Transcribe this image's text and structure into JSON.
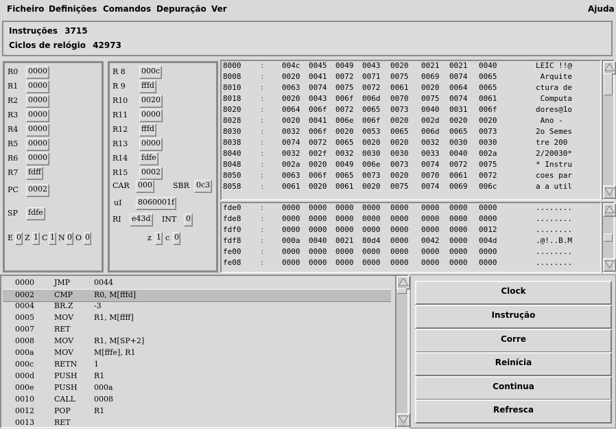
{
  "menu": {
    "items": [
      "Ficheiro",
      "Definições",
      "Comandos",
      "Depuração",
      "Ver"
    ],
    "help": "Ajuda"
  },
  "info": {
    "instructions_label": "Instruções",
    "instructions_value": "3715",
    "cycles_label": "Ciclos de relógio",
    "cycles_value": "42973"
  },
  "registers": {
    "r0": {
      "label": "R0",
      "value": "0000"
    },
    "r1": {
      "label": "R1",
      "value": "0000"
    },
    "r2": {
      "label": "R2",
      "value": "0000"
    },
    "r3": {
      "label": "R3",
      "value": "0000"
    },
    "r4": {
      "label": "R4",
      "value": "0000"
    },
    "r5": {
      "label": "R5",
      "value": "0000"
    },
    "r6": {
      "label": "R6",
      "value": "0000"
    },
    "r7": {
      "label": "R7",
      "value": "fdff"
    },
    "pc": {
      "label": "PC",
      "value": "0002"
    },
    "sp": {
      "label": "SP",
      "value": "fdfe"
    },
    "r8": {
      "label": "R 8",
      "value": "000c"
    },
    "r9": {
      "label": "R 9",
      "value": "fffd"
    },
    "r10": {
      "label": "R10",
      "value": "0020"
    },
    "r11": {
      "label": "R11",
      "value": "0000"
    },
    "r12": {
      "label": "R12",
      "value": "fffd"
    },
    "r13": {
      "label": "R13",
      "value": "0000"
    },
    "r14": {
      "label": "R14",
      "value": "fdfe"
    },
    "r15": {
      "label": "R15",
      "value": "0002"
    },
    "car": {
      "label": "CAR",
      "value": "000"
    },
    "sbr": {
      "label": "SBR",
      "value": "0c3"
    },
    "ui": {
      "label": "uI",
      "value": "8060001f"
    },
    "ri": {
      "label": "RI",
      "value": "e43d"
    },
    "int": {
      "label": "INT",
      "value": "0"
    }
  },
  "flags": {
    "e": {
      "label": "E",
      "value": "0"
    },
    "z": {
      "label": "Z",
      "value": "1"
    },
    "c": {
      "label": "C",
      "value": "1"
    },
    "n": {
      "label": "N",
      "value": "0"
    },
    "o": {
      "label": "O",
      "value": "0"
    },
    "z2": {
      "label": "z",
      "value": "1"
    },
    "c2": {
      "label": "c",
      "value": "0"
    }
  },
  "memory_top": [
    {
      "addr": "8000",
      "words": [
        "004c",
        "0045",
        "0049",
        "0043",
        "0020",
        "0021",
        "0021",
        "0040"
      ],
      "ascii": "LEIC !!@"
    },
    {
      "addr": "8008",
      "words": [
        "0020",
        "0041",
        "0072",
        "0071",
        "0075",
        "0069",
        "0074",
        "0065"
      ],
      "ascii": " Arquite"
    },
    {
      "addr": "8010",
      "words": [
        "0063",
        "0074",
        "0075",
        "0072",
        "0061",
        "0020",
        "0064",
        "0065"
      ],
      "ascii": "ctura de"
    },
    {
      "addr": "8018",
      "words": [
        "0020",
        "0043",
        "006f",
        "006d",
        "0070",
        "0075",
        "0074",
        "0061"
      ],
      "ascii": " Computa"
    },
    {
      "addr": "8020",
      "words": [
        "0064",
        "006f",
        "0072",
        "0065",
        "0073",
        "0040",
        "0031",
        "006f"
      ],
      "ascii": "dores@1o"
    },
    {
      "addr": "8028",
      "words": [
        "0020",
        "0041",
        "006e",
        "006f",
        "0020",
        "002d",
        "0020",
        "0020"
      ],
      "ascii": " Ano - "
    },
    {
      "addr": "8030",
      "words": [
        "0032",
        "006f",
        "0020",
        "0053",
        "0065",
        "006d",
        "0065",
        "0073"
      ],
      "ascii": "2o Semes"
    },
    {
      "addr": "8038",
      "words": [
        "0074",
        "0072",
        "0065",
        "0020",
        "0020",
        "0032",
        "0030",
        "0030"
      ],
      "ascii": "tre 200"
    },
    {
      "addr": "8040",
      "words": [
        "0032",
        "002f",
        "0032",
        "0030",
        "0030",
        "0033",
        "0040",
        "002a"
      ],
      "ascii": "2/20030*"
    },
    {
      "addr": "8048",
      "words": [
        "002a",
        "0020",
        "0049",
        "006e",
        "0073",
        "0074",
        "0072",
        "0075"
      ],
      "ascii": "* Instru"
    },
    {
      "addr": "8050",
      "words": [
        "0063",
        "006f",
        "0065",
        "0073",
        "0020",
        "0070",
        "0061",
        "0072"
      ],
      "ascii": "coes par"
    },
    {
      "addr": "8058",
      "words": [
        "0061",
        "0020",
        "0061",
        "0020",
        "0075",
        "0074",
        "0069",
        "006c"
      ],
      "ascii": "a a util"
    }
  ],
  "memory_bottom": [
    {
      "addr": "fde0",
      "words": [
        "0000",
        "0000",
        "0000",
        "0000",
        "0000",
        "0000",
        "0000",
        "0000"
      ],
      "ascii": "........"
    },
    {
      "addr": "fde8",
      "words": [
        "0000",
        "0000",
        "0000",
        "0000",
        "0000",
        "0000",
        "0000",
        "0000"
      ],
      "ascii": "........"
    },
    {
      "addr": "fdf0",
      "words": [
        "0000",
        "0000",
        "0000",
        "0000",
        "0000",
        "0000",
        "0000",
        "0012"
      ],
      "ascii": "........"
    },
    {
      "addr": "fdf8",
      "words": [
        "000a",
        "0040",
        "0021",
        "80d4",
        "0000",
        "0042",
        "0000",
        "004d"
      ],
      "ascii": ".@!..B.M"
    },
    {
      "addr": "fe00",
      "words": [
        "0000",
        "0000",
        "0000",
        "0000",
        "0000",
        "0000",
        "0000",
        "0000"
      ],
      "ascii": "........"
    },
    {
      "addr": "fe08",
      "words": [
        "0000",
        "0000",
        "0000",
        "0000",
        "0000",
        "0000",
        "0000",
        "0000"
      ],
      "ascii": "........"
    }
  ],
  "code": [
    {
      "addr": "0000",
      "op": "JMP",
      "args": "0044"
    },
    {
      "addr": "0002",
      "op": "CMP",
      "args": "R0, M[fffd]"
    },
    {
      "addr": "0004",
      "op": "BR.Z",
      "args": "-3"
    },
    {
      "addr": "0005",
      "op": "MOV",
      "args": "R1, M[ffff]"
    },
    {
      "addr": "0007",
      "op": "RET",
      "args": ""
    },
    {
      "addr": "0008",
      "op": "MOV",
      "args": "R1, M[SP+2]"
    },
    {
      "addr": "000a",
      "op": "MOV",
      "args": "M[fffe], R1"
    },
    {
      "addr": "000c",
      "op": "RETN",
      "args": "1"
    },
    {
      "addr": "000d",
      "op": "PUSH",
      "args": "R1"
    },
    {
      "addr": "000e",
      "op": "PUSH",
      "args": "000a"
    },
    {
      "addr": "0010",
      "op": "CALL",
      "args": "0008"
    },
    {
      "addr": "0012",
      "op": "POP",
      "args": "R1"
    },
    {
      "addr": "0013",
      "op": "RET",
      "args": ""
    }
  ],
  "code_selected_index": 1,
  "buttons": {
    "clock": "Clock",
    "instrucao": "Instrução",
    "corre": "Corre",
    "reinicia": "Reinícia",
    "continua": "Continua",
    "refresca": "Refresca"
  }
}
